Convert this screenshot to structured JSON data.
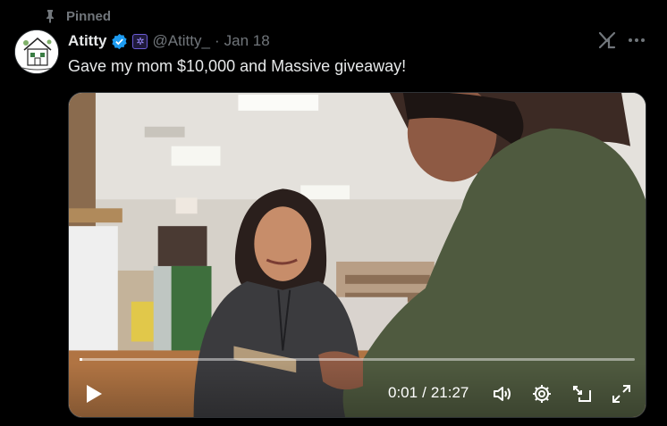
{
  "pinned": {
    "label": "Pinned"
  },
  "author": {
    "name": "Atitty",
    "handle": "@Atitty_",
    "date": "Jan 18"
  },
  "separator": "·",
  "post": {
    "text": "Gave my mom $10,000 and Massive giveaway!"
  },
  "video": {
    "current_time": "0:01",
    "time_separator": "/",
    "duration": "21:27",
    "progress_fraction": 0.0008,
    "icons": [
      "play-icon",
      "volume-icon",
      "settings-icon",
      "picture-in-picture-icon",
      "fullscreen-icon"
    ]
  },
  "icons": [
    "pin-icon",
    "verified-badge-icon",
    "affiliate-badge-icon",
    "grok-icon",
    "more-icon"
  ],
  "colors": {
    "background": "#000000",
    "text": "#e7e9ea",
    "muted": "#71767b",
    "verified": "#1d9bf0"
  }
}
